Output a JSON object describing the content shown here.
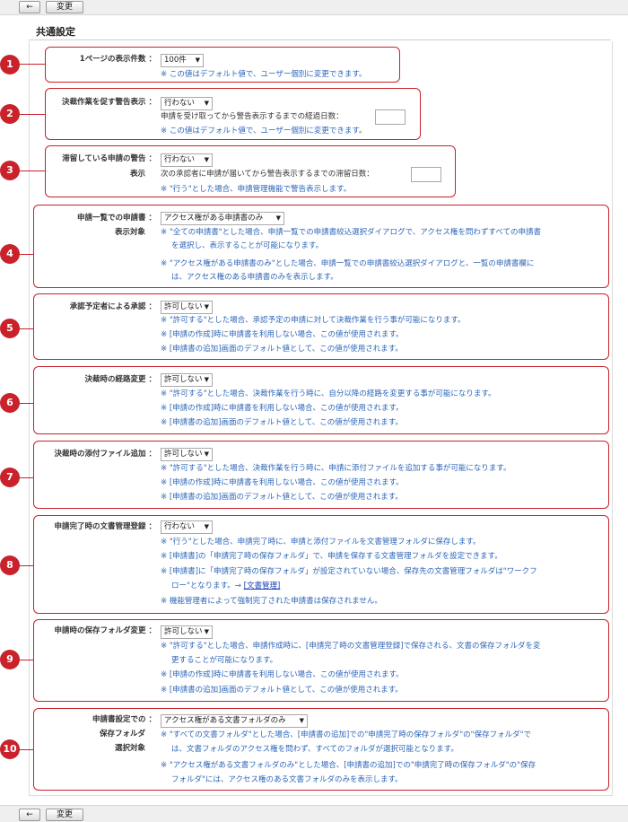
{
  "toolbar": {
    "back_icon": "back-arrow-icon",
    "change_label": "変更"
  },
  "page_title": "共通設定",
  "settings": [
    {
      "num": "1",
      "label": "1ページの表示件数 ：",
      "value": "100件",
      "notes": [
        "※ この値はデフォルト値で、ユーザー個別に変更できます。"
      ]
    },
    {
      "num": "2",
      "label": "決裁作業を促す警告表示 ：",
      "value": "行わない",
      "field_label": "申請を受け取ってから警告表示するまでの経過日数：",
      "notes": [
        "※ この値はデフォルト値で、ユーザー個別に変更できます。"
      ]
    },
    {
      "num": "3",
      "label_line1": "滞留している申請の警告 ：",
      "label_line2": "表示",
      "value": "行わない",
      "field_label": "次の承認者に申請が届いてから警告表示するまでの滞留日数：",
      "notes": [
        "※ \"行う\"とした場合、申請管理機能で警告表示します。"
      ]
    },
    {
      "num": "4",
      "label_line1": "申請一覧での申請書 ：",
      "label_line2": "表示対象",
      "value": "アクセス権がある申請書のみ",
      "notes": [
        "※ \"全ての申請書\"とした場合、申請一覧での申請書絞込選択ダイアログで、アクセス権を問わずすべての申請書",
        "を選択し、表示することが可能になります。",
        "※ \"アクセス権がある申請書のみ\"とした場合、申請一覧での申請書絞込選択ダイアログと、一覧の申請書欄に",
        "は、アクセス権のある申請書のみを表示します。"
      ]
    },
    {
      "num": "5",
      "label": "承認予定者による承認 ：",
      "value": "許可しない",
      "notes": [
        "※ \"許可する\"とした場合、承認予定の申請に対して決裁作業を行う事が可能になります。",
        "※ [申請の作成]時に申請書を利用しない場合、この値が使用されます。",
        "※ [申請書の追加]画面のデフォルト値として、この値が使用されます。"
      ]
    },
    {
      "num": "6",
      "label": "決裁時の経路変更 ：",
      "value": "許可しない",
      "notes": [
        "※ \"許可する\"とした場合、決裁作業を行う時に、自分以降の経路を変更する事が可能になります。",
        "※ [申請の作成]時に申請書を利用しない場合、この値が使用されます。",
        "※ [申請書の追加]画面のデフォルト値として、この値が使用されます。"
      ]
    },
    {
      "num": "7",
      "label": "決裁時の添付ファイル追加 ：",
      "value": "許可しない",
      "notes": [
        "※ \"許可する\"とした場合、決裁作業を行う時に、申請に添付ファイルを追加する事が可能になります。",
        "※ [申請の作成]時に申請書を利用しない場合、この値が使用されます。",
        "※ [申請書の追加]画面のデフォルト値として、この値が使用されます。"
      ]
    },
    {
      "num": "8",
      "label": "申請完了時の文書管理登録 ：",
      "value": "行わない",
      "notes": [
        "※ \"行う\"とした場合、申請完了時に、申請と添付ファイルを文書管理フォルダに保存します。",
        "※ [申請書]の「申請完了時の保存フォルダ」で、申請を保存する文書管理フォルダを設定できます。",
        "※ [申請書]に「申請完了時の保存フォルダ」が設定されていない場合、保存先の文書管理フォルダは\"ワークフ",
        "ロー\"となります。→ ",
        "※ 機能管理者によって強制完了された申請書は保存されません。"
      ],
      "link": "[文書管理]"
    },
    {
      "num": "9",
      "label": "申請時の保存フォルダ変更 ：",
      "value": "許可しない",
      "notes": [
        "※ \"許可する\"とした場合、申請作成時に、[申請完了時の文書管理登録]で保存される、文書の保存フォルダを変",
        "更することが可能になります。",
        "※ [申請の作成]時に申請書を利用しない場合、この値が使用されます。",
        "※ [申請書の追加]画面のデフォルト値として、この値が使用されます。"
      ]
    },
    {
      "num": "10",
      "label_line1": "申請書設定での ：",
      "label_line2": "保存フォルダ",
      "label_line3": "選択対象",
      "value": "アクセス権がある文書フォルダのみ",
      "notes": [
        "※ \"すべての文書フォルダ\"とした場合、[申請書の追加]での\"申請完了時の保存フォルダ\"の\"保存フォルダ\"で",
        "は、文書フォルダのアクセス権を問わず、すべてのフォルダが選択可能となります。",
        "※ \"アクセス権がある文書フォルダのみ\"とした場合、[申請書の追加]での\"申請完了時の保存フォルダ\"の\"保存",
        "フォルダ\"には、アクセス権のある文書フォルダのみを表示します。"
      ]
    }
  ]
}
